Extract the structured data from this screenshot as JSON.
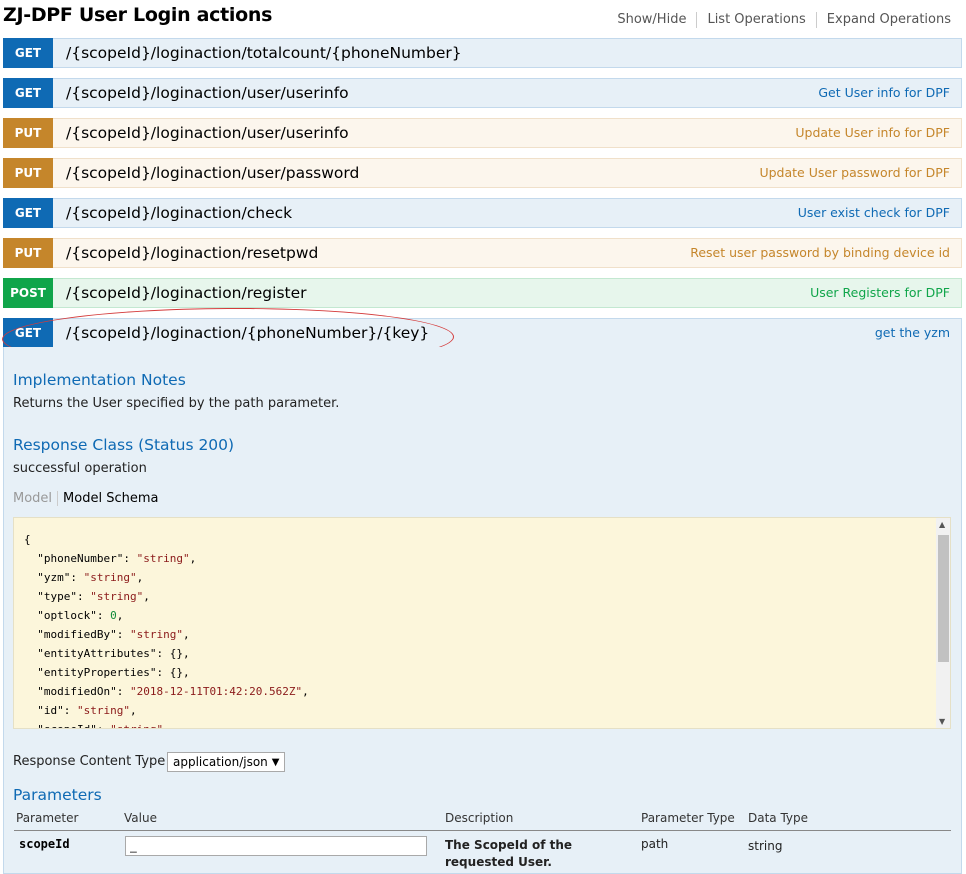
{
  "header": {
    "title": "ZJ-DPF User Login actions",
    "links": {
      "show_hide": "Show/Hide",
      "list_operations": "List Operations",
      "expand_operations": "Expand Operations"
    }
  },
  "operations": [
    {
      "method": "GET",
      "path": "/{scopeId}/loginaction/totalcount/{phoneNumber}",
      "summary": ""
    },
    {
      "method": "GET",
      "path": "/{scopeId}/loginaction/user/userinfo",
      "summary": "Get User info for DPF"
    },
    {
      "method": "PUT",
      "path": "/{scopeId}/loginaction/user/userinfo",
      "summary": "Update User info for DPF"
    },
    {
      "method": "PUT",
      "path": "/{scopeId}/loginaction/user/password",
      "summary": "Update User password for DPF"
    },
    {
      "method": "GET",
      "path": "/{scopeId}/loginaction/check",
      "summary": "User exist check for DPF"
    },
    {
      "method": "PUT",
      "path": "/{scopeId}/loginaction/resetpwd",
      "summary": "Reset user password by binding device id"
    },
    {
      "method": "POST",
      "path": "/{scopeId}/loginaction/register",
      "summary": "User Registers for DPF"
    },
    {
      "method": "GET",
      "path": "/{scopeId}/loginaction/{phoneNumber}/{key}",
      "summary": "get the yzm"
    }
  ],
  "colors": {
    "get": "#0f6ab4",
    "put": "#c5862b",
    "post": "#10a54a",
    "annotation_oval": "#d43c3c"
  },
  "details": {
    "impl_heading": "Implementation Notes",
    "impl_text": "Returns the User specified by the path parameter.",
    "response_heading": "Response Class (Status 200)",
    "response_text": "successful operation",
    "model_tab": "Model",
    "schema_tab": "Model Schema",
    "schema_lines": [
      {
        "key": "",
        "val": "{",
        "kind": "brace"
      },
      {
        "key": "phoneNumber",
        "val": "\"string\"",
        "kind": "str"
      },
      {
        "key": "yzm",
        "val": "\"string\"",
        "kind": "str"
      },
      {
        "key": "type",
        "val": "\"string\"",
        "kind": "str"
      },
      {
        "key": "optlock",
        "val": "0",
        "kind": "num"
      },
      {
        "key": "modifiedBy",
        "val": "\"string\"",
        "kind": "str"
      },
      {
        "key": "entityAttributes",
        "val": "{}",
        "kind": "plain"
      },
      {
        "key": "entityProperties",
        "val": "{}",
        "kind": "plain"
      },
      {
        "key": "modifiedOn",
        "val": "\"2018-12-11T01:42:20.562Z\"",
        "kind": "str"
      },
      {
        "key": "id",
        "val": "\"string\"",
        "kind": "str"
      },
      {
        "key": "scopeId",
        "val": "\"string\"",
        "kind": "str"
      }
    ],
    "response_content_type_label": "Response Content Type",
    "response_content_type_value": "application/json",
    "parameters_heading": "Parameters",
    "param_columns": {
      "parameter": "Parameter",
      "value": "Value",
      "description": "Description",
      "parameter_type": "Parameter Type",
      "data_type": "Data Type"
    },
    "params": [
      {
        "name": "scopeId",
        "value": "_",
        "description": "The ScopeId of the requested User.",
        "param_type": "path",
        "data_type": "string"
      }
    ]
  }
}
